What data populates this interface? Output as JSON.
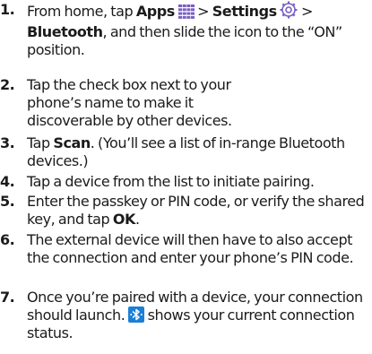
{
  "steps": [
    {
      "number": "1.",
      "parts": {
        "t1": "From home, tap ",
        "b1": "Apps",
        "t2": " > ",
        "b2": "Settings",
        "t3": " > ",
        "b3": "Bluetooth",
        "t4": ", and then slide the icon to the “ON” position."
      },
      "icons": [
        "apps-grid-icon",
        "settings-gear-icon"
      ]
    },
    {
      "number": "2.",
      "text": "Tap the check box next to your phone’s name to make it discoverable by other devices."
    },
    {
      "number": "3.",
      "parts": {
        "t1": "Tap ",
        "b1": "Scan",
        "t2": ". (You’ll see a list of in-range Bluetooth devices.)"
      }
    },
    {
      "number": "4.",
      "text": "Tap a device from the list to initiate pairing."
    },
    {
      "number": "5.",
      "parts": {
        "t1": "Enter the passkey or PIN code, or verify the shared key, and tap ",
        "b1": "OK",
        "t2": "."
      }
    },
    {
      "number": "6.",
      "text": "The external device will then have to also accept the connection and enter your phone’s PIN code."
    },
    {
      "number": "7.",
      "parts": {
        "t1": "Once you’re paired with a device, your connection should launch. ",
        "t2": " shows your current connection status."
      },
      "icons": [
        "bluetooth-connected-icon"
      ]
    }
  ],
  "colors": {
    "text": "#1b1b1b",
    "apps_icon": "#7a5ec4",
    "settings_icon": "#7a5ec4",
    "bluetooth_badge": "#1c7fd6"
  }
}
